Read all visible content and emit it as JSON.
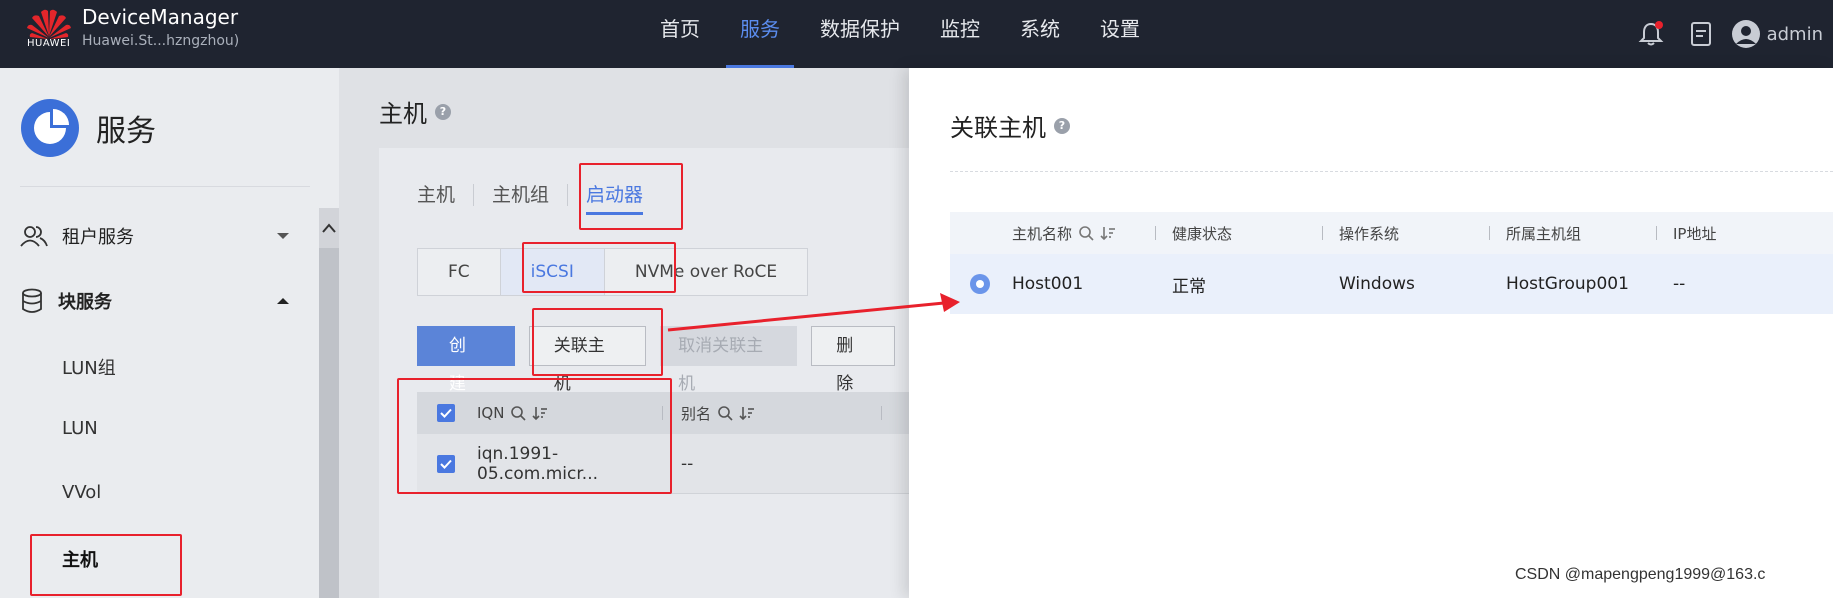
{
  "topbar": {
    "brand_logo_text": "HUAWEI",
    "app_title": "DeviceManager",
    "app_subtitle": "Huawei.St...hzngzhou)",
    "nav": [
      "首页",
      "服务",
      "数据保护",
      "监控",
      "系统",
      "设置"
    ],
    "active_nav": "服务",
    "user": "admin",
    "accent": "#4a78e0"
  },
  "sidebar": {
    "title": "服务",
    "groups": [
      {
        "label": "租户服务",
        "expanded": false
      },
      {
        "label": "块服务",
        "expanded": true
      }
    ],
    "items": [
      "LUN组",
      "LUN",
      "VVol",
      "主机"
    ],
    "selected_item": "主机"
  },
  "main": {
    "title": "主机",
    "tabs": [
      "主机",
      "主机组",
      "启动器"
    ],
    "active_tab": "启动器",
    "protocols": [
      "FC",
      "iSCSI",
      "NVMe over RoCE"
    ],
    "active_protocol": "iSCSI",
    "buttons": {
      "create": "创建",
      "associate": "关联主机",
      "disassociate": "取消关联主机",
      "delete": "删除"
    },
    "table": {
      "columns": [
        "IQN",
        "别名"
      ],
      "rows": [
        {
          "iqn": "iqn.1991-05.com.micr...",
          "alias": "--"
        }
      ]
    }
  },
  "drawer": {
    "title": "关联主机",
    "columns": [
      "主机名称",
      "健康状态",
      "操作系统",
      "所属主机组",
      "IP地址"
    ],
    "rows": [
      {
        "name": "Host001",
        "health": "正常",
        "os": "Windows",
        "group": "HostGroup001",
        "ip": "--"
      }
    ]
  },
  "watermark": "CSDN @mapengpeng1999@163.c"
}
